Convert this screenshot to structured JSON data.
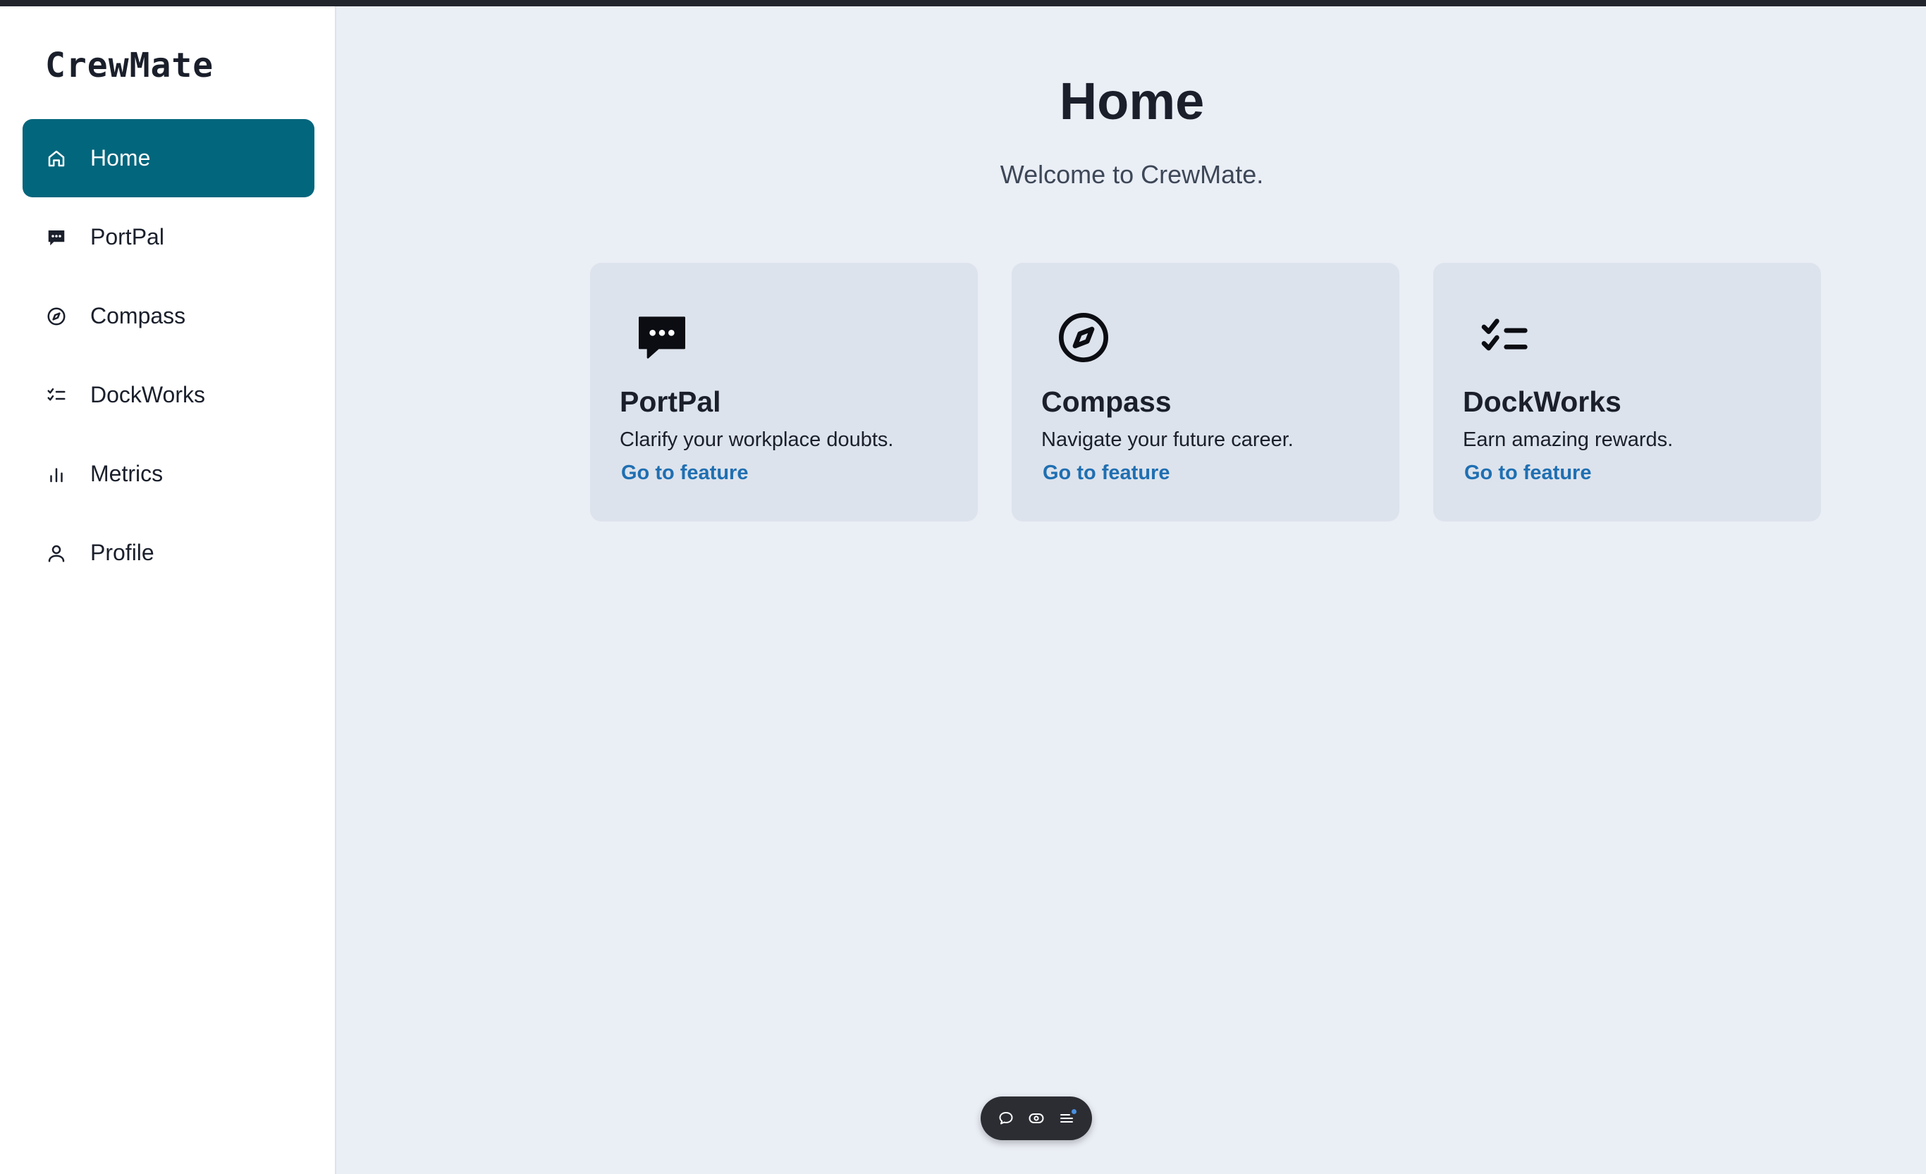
{
  "app": {
    "name": "CrewMate"
  },
  "sidebar": {
    "items": [
      {
        "label": "Home",
        "icon": "home-icon",
        "active": true
      },
      {
        "label": "PortPal",
        "icon": "chat-bubble-icon",
        "active": false
      },
      {
        "label": "Compass",
        "icon": "compass-icon",
        "active": false
      },
      {
        "label": "DockWorks",
        "icon": "checklist-icon",
        "active": false
      },
      {
        "label": "Metrics",
        "icon": "bar-chart-icon",
        "active": false
      },
      {
        "label": "Profile",
        "icon": "user-icon",
        "active": false
      }
    ]
  },
  "main": {
    "title": "Home",
    "subtitle": "Welcome to CrewMate.",
    "cards": [
      {
        "title": "PortPal",
        "description": "Clarify your workplace doubts.",
        "link": "Go to feature",
        "icon": "chat-bubble-icon"
      },
      {
        "title": "Compass",
        "description": "Navigate your future career.",
        "link": "Go to feature",
        "icon": "compass-icon"
      },
      {
        "title": "DockWorks",
        "description": "Earn amazing rewards.",
        "link": "Go to feature",
        "icon": "checklist-icon"
      }
    ]
  },
  "toolbar": {
    "buttons": [
      "comment-icon",
      "eye-icon",
      "menu-icon"
    ]
  },
  "colors": {
    "accent": "#02667d",
    "link": "#1f6fb2",
    "background": "#eaeef5",
    "card": "#dde3ec"
  }
}
